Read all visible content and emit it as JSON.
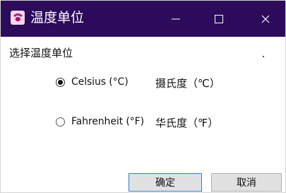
{
  "window": {
    "title": "温度单位",
    "icon": "paw-icon",
    "title_bar_color": "#2b0b5a",
    "controls": {
      "minimize": "minimize-icon",
      "maximize": "maximize-icon",
      "close": "close-icon"
    }
  },
  "dialog": {
    "section_label": "选择温度单位",
    "options": [
      {
        "label": "Celsius (°C)",
        "cn_label": "摄氏度（℃）",
        "checked": true
      },
      {
        "label": "Fahrenheit (°F)",
        "cn_label": "华氏度（℉）",
        "checked": false
      }
    ],
    "buttons": {
      "ok": "确定",
      "cancel": "取消"
    }
  }
}
